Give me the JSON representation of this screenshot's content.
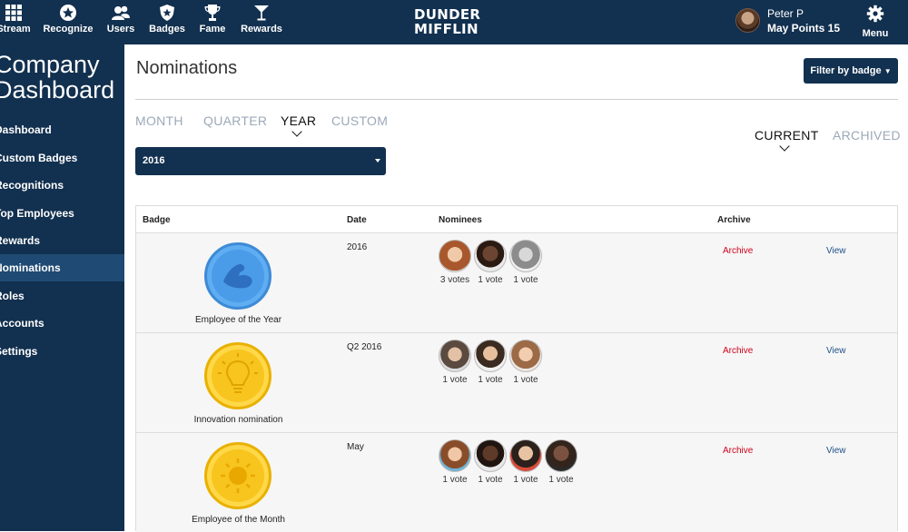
{
  "nav": {
    "items": [
      {
        "label": "Stream",
        "icon": "grid-icon"
      },
      {
        "label": "Recognize",
        "icon": "star-icon"
      },
      {
        "label": "Users",
        "icon": "users-icon"
      },
      {
        "label": "Badges",
        "icon": "shield-icon"
      },
      {
        "label": "Fame",
        "icon": "trophy-icon"
      },
      {
        "label": "Rewards",
        "icon": "cocktail-icon"
      }
    ],
    "logo_line1": "DUNDER",
    "logo_line2": "MIFFLIN",
    "user_name": "Peter P",
    "user_points": "May Points 15",
    "menu_label": "Menu"
  },
  "sidebar": {
    "title_line1": "Company",
    "title_line2": "Dashboard",
    "items": [
      {
        "label": "Dashboard"
      },
      {
        "label": "Custom Badges"
      },
      {
        "label": "Recognitions"
      },
      {
        "label": "Top Employees"
      },
      {
        "label": "Rewards"
      },
      {
        "label": "Nominations",
        "active": true
      },
      {
        "label": "Roles"
      },
      {
        "label": "Accounts"
      },
      {
        "label": "Settings"
      }
    ]
  },
  "main": {
    "title": "Nominations",
    "filter_button": "Filter by badge",
    "period_tabs": [
      {
        "label": "MONTH"
      },
      {
        "label": "QUARTER"
      },
      {
        "label": "YEAR",
        "active": true
      },
      {
        "label": "CUSTOM"
      }
    ],
    "year_select": "2016",
    "status_tabs": [
      {
        "label": "CURRENT",
        "active": true
      },
      {
        "label": "ARCHIVED"
      }
    ]
  },
  "table": {
    "headers": {
      "badge": "Badge",
      "date": "Date",
      "nominees": "Nominees",
      "archive": "Archive"
    },
    "rows": [
      {
        "badge": "Employee of the Year",
        "badge_icon": "arm-icon",
        "date": "2016",
        "nominees": [
          {
            "votes": "3 votes"
          },
          {
            "votes": "1 vote"
          },
          {
            "votes": "1 vote"
          }
        ],
        "archive": "Archive",
        "view": "View"
      },
      {
        "badge": "Innovation nomination",
        "badge_icon": "lightbulb-icon",
        "date": "Q2 2016",
        "nominees": [
          {
            "votes": "1 vote"
          },
          {
            "votes": "1 vote"
          },
          {
            "votes": "1 vote"
          }
        ],
        "archive": "Archive",
        "view": "View"
      },
      {
        "badge": "Employee of the Month",
        "badge_icon": "sun-icon",
        "date": "May",
        "nominees": [
          {
            "votes": "1 vote"
          },
          {
            "votes": "1 vote"
          },
          {
            "votes": "1 vote"
          },
          {
            "votes": "1 vote"
          }
        ],
        "archive": "Archive",
        "view": "View"
      }
    ]
  },
  "colors": {
    "navy": "#12304f",
    "sidebar_active": "#1f4a73",
    "archive_red": "#d0021b",
    "link_blue": "#1f4f86",
    "badge_blue": "#4a9be8",
    "badge_yellow": "#f7c51e"
  }
}
